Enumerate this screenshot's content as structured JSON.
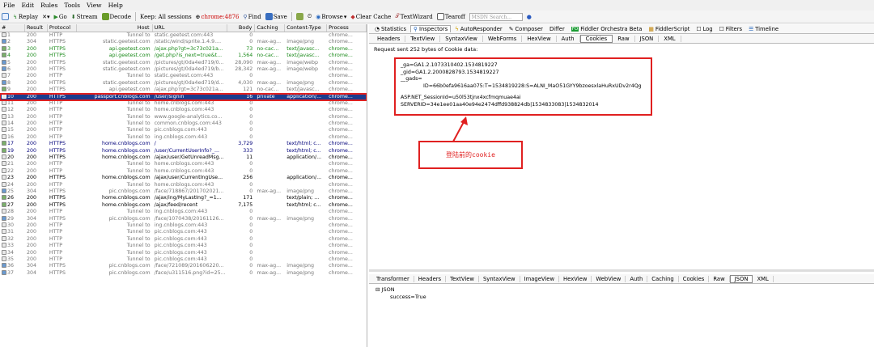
{
  "menu": [
    "File",
    "Edit",
    "Rules",
    "Tools",
    "View",
    "Help"
  ],
  "toolbar": {
    "replay": "Replay",
    "go": "Go",
    "stream": "Stream",
    "decode": "Decode",
    "keep": "Keep: All sessions",
    "process": "chrome:4876",
    "find": "Find",
    "save": "Save",
    "browse": "Browse",
    "clear_cache": "Clear Cache",
    "textwizard": "TextWizard",
    "tearoff": "Tearoff",
    "search_placeholder": "MSDN Search..."
  },
  "sessions": {
    "headers": [
      "#",
      "Result",
      "Protocol",
      "Host",
      "URL",
      "Body",
      "Caching",
      "Content-Type",
      "Process"
    ],
    "rows": [
      {
        "n": "1",
        "r": "200",
        "p": "HTTP",
        "h": "Tunnel to",
        "u": "static.geetest.com:443",
        "b": "0",
        "c": "",
        "t": "",
        "pr": "chrome...",
        "s": "g"
      },
      {
        "n": "2",
        "r": "304",
        "p": "HTTPS",
        "h": "static.geetest.com",
        "u": "/static/wind/sprite.1.4.9....",
        "b": "0",
        "c": "max-ag...",
        "t": "image/png",
        "pr": "chrome...",
        "s": "g"
      },
      {
        "n": "3",
        "r": "200",
        "p": "HTTPS",
        "h": "api.geetest.com",
        "u": "/ajax.php?gt=3c73c021a...",
        "b": "73",
        "c": "no-cac...",
        "t": "text/javasc...",
        "pr": "chrome...",
        "s": "d",
        "col": "#1a8a1a"
      },
      {
        "n": "4",
        "r": "200",
        "p": "HTTPS",
        "h": "api.geetest.com",
        "u": "/get.php?is_next=true&t...",
        "b": "1,564",
        "c": "no-cac...",
        "t": "text/javasc...",
        "pr": "chrome...",
        "s": "d",
        "col": "#1a8a1a"
      },
      {
        "n": "5",
        "r": "200",
        "p": "HTTPS",
        "h": "static.geetest.com",
        "u": "/pictures/gt/0da4ed719/0...",
        "b": "28,090",
        "c": "max-ag...",
        "t": "image/webp",
        "pr": "chrome...",
        "s": "g"
      },
      {
        "n": "6",
        "r": "200",
        "p": "HTTPS",
        "h": "static.geetest.com",
        "u": "/pictures/gt/0da4ed719/b...",
        "b": "28,342",
        "c": "max-ag...",
        "t": "image/webp",
        "pr": "chrome...",
        "s": "g"
      },
      {
        "n": "7",
        "r": "200",
        "p": "HTTP",
        "h": "Tunnel to",
        "u": "static.geetest.com:443",
        "b": "0",
        "c": "",
        "t": "",
        "pr": "chrome...",
        "s": "g"
      },
      {
        "n": "8",
        "r": "200",
        "p": "HTTPS",
        "h": "static.geetest.com",
        "u": "/pictures/gt/0da4ed719/d...",
        "b": "4,030",
        "c": "max-ag...",
        "t": "image/png",
        "pr": "chrome...",
        "s": "g"
      },
      {
        "n": "9",
        "r": "200",
        "p": "HTTPS",
        "h": "api.geetest.com",
        "u": "/ajax.php?gt=3c73c021a...",
        "b": "121",
        "c": "no-cac...",
        "t": "text/javasc...",
        "pr": "chrome...",
        "s": "g"
      },
      {
        "n": "10",
        "r": "200",
        "p": "HTTPS",
        "h": "passport.cnblogs.com",
        "u": "/user/signin",
        "b": "16",
        "c": "private",
        "t": "application/...",
        "pr": "chrome...",
        "s": "sel"
      },
      {
        "n": "11",
        "r": "200",
        "p": "HTTP",
        "h": "Tunnel to",
        "u": "home.cnblogs.com:443",
        "b": "0",
        "c": "",
        "t": "",
        "pr": "chrome...",
        "s": "g"
      },
      {
        "n": "12",
        "r": "200",
        "p": "HTTP",
        "h": "Tunnel to",
        "u": "home.cnblogs.com:443",
        "b": "0",
        "c": "",
        "t": "",
        "pr": "chrome...",
        "s": "g"
      },
      {
        "n": "13",
        "r": "200",
        "p": "HTTP",
        "h": "Tunnel to",
        "u": "www.google-analytics.co...",
        "b": "0",
        "c": "",
        "t": "",
        "pr": "chrome...",
        "s": "g"
      },
      {
        "n": "14",
        "r": "200",
        "p": "HTTP",
        "h": "Tunnel to",
        "u": "common.cnblogs.com:443",
        "b": "0",
        "c": "",
        "t": "",
        "pr": "chrome...",
        "s": "g"
      },
      {
        "n": "15",
        "r": "200",
        "p": "HTTP",
        "h": "Tunnel to",
        "u": "pic.cnblogs.com:443",
        "b": "0",
        "c": "",
        "t": "",
        "pr": "chrome...",
        "s": "g"
      },
      {
        "n": "16",
        "r": "200",
        "p": "HTTP",
        "h": "Tunnel to",
        "u": "ing.cnblogs.com:443",
        "b": "0",
        "c": "",
        "t": "",
        "pr": "chrome...",
        "s": "g"
      },
      {
        "n": "17",
        "r": "200",
        "p": "HTTPS",
        "h": "home.cnblogs.com",
        "u": "/",
        "b": "3,729",
        "c": "",
        "t": "text/html; c...",
        "pr": "chrome...",
        "s": "d"
      },
      {
        "n": "19",
        "r": "200",
        "p": "HTTPS",
        "h": "home.cnblogs.com",
        "u": "/user/CurrentUserInfo?_...",
        "b": "333",
        "c": "",
        "t": "text/html; c...",
        "pr": "chrome...",
        "s": "d"
      },
      {
        "n": "20",
        "r": "200",
        "p": "HTTPS",
        "h": "home.cnblogs.com",
        "u": "/ajax/user/GetUnreadMsg...",
        "b": "11",
        "c": "",
        "t": "application/...",
        "pr": "chrome...",
        "s": "b"
      },
      {
        "n": "21",
        "r": "200",
        "p": "HTTP",
        "h": "Tunnel to",
        "u": "home.cnblogs.com:443",
        "b": "0",
        "c": "",
        "t": "",
        "pr": "chrome...",
        "s": "g"
      },
      {
        "n": "22",
        "r": "200",
        "p": "HTTP",
        "h": "Tunnel to",
        "u": "home.cnblogs.com:443",
        "b": "0",
        "c": "",
        "t": "",
        "pr": "chrome...",
        "s": "g"
      },
      {
        "n": "23",
        "r": "200",
        "p": "HTTPS",
        "h": "home.cnblogs.com",
        "u": "/ajax/user/CurrentIngUse...",
        "b": "256",
        "c": "",
        "t": "application/...",
        "pr": "chrome...",
        "s": "b"
      },
      {
        "n": "24",
        "r": "200",
        "p": "HTTP",
        "h": "Tunnel to",
        "u": "home.cnblogs.com:443",
        "b": "0",
        "c": "",
        "t": "",
        "pr": "chrome...",
        "s": "g"
      },
      {
        "n": "25",
        "r": "304",
        "p": "HTTPS",
        "h": "pic.cnblogs.com",
        "u": "/face/718867/201702021...",
        "b": "0",
        "c": "max-ag...",
        "t": "image/png",
        "pr": "chrome...",
        "s": "g"
      },
      {
        "n": "26",
        "r": "200",
        "p": "HTTPS",
        "h": "home.cnblogs.com",
        "u": "/ajax/ing/MyLastIng?_=1...",
        "b": "171",
        "c": "",
        "t": "text/plain; ...",
        "pr": "chrome...",
        "s": "b"
      },
      {
        "n": "27",
        "r": "200",
        "p": "HTTPS",
        "h": "home.cnblogs.com",
        "u": "/ajax/feed/recent",
        "b": "7,175",
        "c": "",
        "t": "text/html; c...",
        "pr": "chrome...",
        "s": "b"
      },
      {
        "n": "28",
        "r": "200",
        "p": "HTTP",
        "h": "Tunnel to",
        "u": "ing.cnblogs.com:443",
        "b": "0",
        "c": "",
        "t": "",
        "pr": "chrome...",
        "s": "g"
      },
      {
        "n": "29",
        "r": "304",
        "p": "HTTPS",
        "h": "pic.cnblogs.com",
        "u": "/face/1070438/20161126...",
        "b": "0",
        "c": "max-ag...",
        "t": "image/png",
        "pr": "chrome...",
        "s": "g"
      },
      {
        "n": "30",
        "r": "200",
        "p": "HTTP",
        "h": "Tunnel to",
        "u": "ing.cnblogs.com:443",
        "b": "0",
        "c": "",
        "t": "",
        "pr": "chrome...",
        "s": "g"
      },
      {
        "n": "31",
        "r": "200",
        "p": "HTTP",
        "h": "Tunnel to",
        "u": "pic.cnblogs.com:443",
        "b": "0",
        "c": "",
        "t": "",
        "pr": "chrome...",
        "s": "g"
      },
      {
        "n": "32",
        "r": "200",
        "p": "HTTP",
        "h": "Tunnel to",
        "u": "pic.cnblogs.com:443",
        "b": "0",
        "c": "",
        "t": "",
        "pr": "chrome...",
        "s": "g"
      },
      {
        "n": "33",
        "r": "200",
        "p": "HTTP",
        "h": "Tunnel to",
        "u": "pic.cnblogs.com:443",
        "b": "0",
        "c": "",
        "t": "",
        "pr": "chrome...",
        "s": "g"
      },
      {
        "n": "34",
        "r": "200",
        "p": "HTTP",
        "h": "Tunnel to",
        "u": "pic.cnblogs.com:443",
        "b": "0",
        "c": "",
        "t": "",
        "pr": "chrome...",
        "s": "g"
      },
      {
        "n": "35",
        "r": "200",
        "p": "HTTP",
        "h": "Tunnel to",
        "u": "pic.cnblogs.com:443",
        "b": "0",
        "c": "",
        "t": "",
        "pr": "chrome...",
        "s": "g"
      },
      {
        "n": "36",
        "r": "304",
        "p": "HTTPS",
        "h": "pic.cnblogs.com",
        "u": "/face/721089/201606220...",
        "b": "0",
        "c": "max-ag...",
        "t": "image/png",
        "pr": "chrome...",
        "s": "g"
      },
      {
        "n": "37",
        "r": "304",
        "p": "HTTPS",
        "h": "pic.cnblogs.com",
        "u": "/face/u311516.png?id=25...",
        "b": "0",
        "c": "max-ag...",
        "t": "image/png",
        "pr": "chrome...",
        "s": "g"
      }
    ]
  },
  "inspector_tabs": [
    "Statistics",
    "Inspectors",
    "AutoResponder",
    "Composer",
    "Differ",
    "Fiddler Orchestra Beta",
    "FiddlerScript",
    "Log",
    "Filters",
    "Timeline"
  ],
  "fo_badge": "FO",
  "request_tabs": [
    "Headers",
    "TextView",
    "SyntaxView",
    "WebForms",
    "HexView",
    "Auth",
    "Cookies",
    "Raw",
    "JSON",
    "XML"
  ],
  "request_info": "Request sent 252 bytes of Cookie data:",
  "cookies": {
    "ga": "_ga=GA1.2.1073310402.1534819227",
    "gid": "_gid=GA1.2.2000828793.1534819227",
    "gads": "__gads=",
    "gads_id": "ID=66b0efa9616aa075:T=1534819228:S=ALNI_MaO51GYY9bzoesxlaHuRxUDv2r4Qg",
    "session": "ASP.NET_SessionId=u50l53tjnx4xcfmqmuae4ai",
    "serverid": "SERVERID=34e1ee01aa40e94e2474dffd938824db|1534833083|1534832014"
  },
  "annotation": "登陆前的cookie",
  "response_tabs": [
    "Transformer",
    "Headers",
    "TextView",
    "SyntaxView",
    "ImageView",
    "HexView",
    "WebView",
    "Auth",
    "Caching",
    "Cookies",
    "Raw",
    "JSON",
    "XML"
  ],
  "response_json": {
    "root": "JSON",
    "item": "success=True"
  }
}
